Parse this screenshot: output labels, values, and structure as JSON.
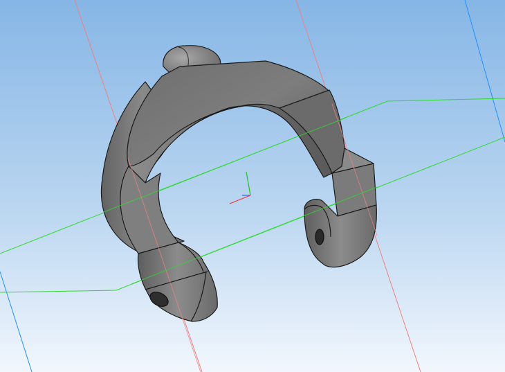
{
  "viewport": {
    "type": "3d-model-viewport",
    "background_top_color": "#86b6e6",
    "background_bottom_color": "#f2f7fd",
    "part_color": "#7a7a7a",
    "edge_color": "#1a1a1a"
  },
  "construction_lines": {
    "plane_color": "#2fd92f",
    "axis_x_color": "#f08080",
    "axis_z_color": "#1e90ff"
  },
  "origin_triad": {
    "x_color": "#ff3030",
    "y_color": "#22c022",
    "z_color": "#1e64ff"
  },
  "model": {
    "part": "split-ring-clamp",
    "features": [
      "top-tab",
      "left-lug-hole",
      "right-lug-hole"
    ]
  }
}
